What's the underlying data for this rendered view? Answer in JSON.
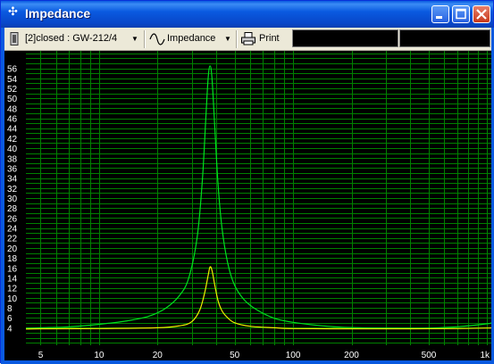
{
  "window": {
    "title": "Impedance"
  },
  "toolbar": {
    "source_label": "[2]closed : GW-212/4",
    "mode_label": "Impedance",
    "print_label": "Print"
  },
  "chart_data": {
    "type": "line",
    "xscale": "log",
    "xlim": [
      4.2,
      1050
    ],
    "ylim": [
      0.5,
      59.5
    ],
    "x_tick_labels": [
      "5",
      "10",
      "20",
      "50",
      "100",
      "200",
      "500",
      "1k"
    ],
    "x_tick_values": [
      5,
      10,
      20,
      50,
      100,
      200,
      500,
      1000
    ],
    "y_tick_labels": [
      "4",
      "6",
      "8",
      "10",
      "12",
      "14",
      "16",
      "18",
      "20",
      "22",
      "24",
      "26",
      "28",
      "30",
      "32",
      "34",
      "36",
      "38",
      "40",
      "42",
      "44",
      "46",
      "48",
      "50",
      "52",
      "54",
      "56"
    ],
    "y_tick_values": [
      4,
      6,
      8,
      10,
      12,
      14,
      16,
      18,
      20,
      22,
      24,
      26,
      28,
      30,
      32,
      34,
      36,
      38,
      40,
      42,
      44,
      46,
      48,
      50,
      52,
      54,
      56
    ],
    "grid": true,
    "series": [
      {
        "color": "#00e020",
        "x": [
          4.2,
          5,
          7,
          10,
          14,
          18,
          22,
          26,
          29,
          32,
          34,
          35.5,
          36.5,
          37.3,
          38.2,
          39.5,
          41,
          43,
          46,
          50,
          56,
          65,
          80,
          100,
          150,
          200,
          300,
          400,
          500,
          700,
          1000,
          1050
        ],
        "y": [
          3.9,
          4.0,
          4.2,
          4.7,
          5.4,
          6.3,
          7.9,
          10.5,
          14.0,
          22.0,
          33.0,
          46.0,
          54.0,
          56.5,
          54.0,
          44.0,
          33.0,
          24.0,
          17.0,
          12.5,
          9.6,
          7.6,
          5.9,
          5.1,
          4.3,
          4.05,
          3.95,
          3.9,
          3.95,
          4.2,
          4.8,
          5.0
        ]
      },
      {
        "color": "#f0f000",
        "x": [
          4.2,
          5,
          10,
          20,
          26,
          30,
          33,
          35,
          36.5,
          37.3,
          38.2,
          39.5,
          41,
          43,
          46,
          50,
          60,
          80,
          100,
          200,
          400,
          700,
          1000,
          1050
        ],
        "y": [
          3.75,
          3.8,
          3.85,
          4.0,
          4.4,
          5.2,
          7.5,
          11.0,
          14.5,
          16.2,
          15.5,
          12.5,
          9.5,
          7.4,
          6.0,
          5.0,
          4.3,
          4.0,
          3.85,
          3.8,
          3.8,
          3.85,
          3.95,
          4.0
        ]
      }
    ]
  }
}
